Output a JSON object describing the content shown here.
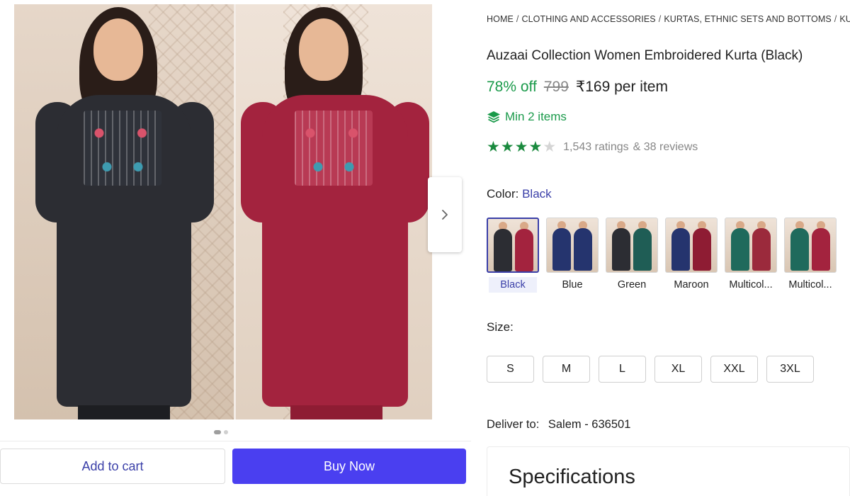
{
  "breadcrumb": {
    "items": [
      "HOME",
      "CLOTHING AND ACCESSORIES",
      "KURTAS, ETHNIC SETS AND BOTTOMS",
      "KURTA"
    ],
    "separator": "/"
  },
  "product": {
    "title": "Auzaai Collection Women Embroidered Kurta (Black)",
    "discount": "78% off",
    "mrp": "799",
    "price": "₹169 per item",
    "min_items": "Min 2 items",
    "rating": {
      "stars_filled": 4,
      "stars_total": 5,
      "ratings_text": "1,543 ratings",
      "reviews_text": "& 38 reviews"
    }
  },
  "gallery": {
    "image_count": 2,
    "active_index": 0,
    "next_icon": "chevron-right-icon",
    "figures": [
      {
        "kurta_color": "#2c2d33",
        "pants_color": "#1d1e22"
      },
      {
        "kurta_color": "#a3233e",
        "pants_color": "#8e1c33"
      }
    ]
  },
  "actions": {
    "add_to_cart": "Add to cart",
    "buy_now": "Buy Now"
  },
  "color": {
    "label": "Color:",
    "selected": "Black",
    "options": [
      {
        "label": "Black",
        "a": "#2c2d33",
        "b": "#a3233e",
        "selected": true
      },
      {
        "label": "Blue",
        "a": "#25346e",
        "b": "#25346e",
        "selected": false
      },
      {
        "label": "Green",
        "a": "#2c2d33",
        "b": "#1f5d55",
        "selected": false
      },
      {
        "label": "Maroon",
        "a": "#25346e",
        "b": "#8e1c33",
        "selected": false
      },
      {
        "label": "Multicol...",
        "a": "#1f6a5c",
        "b": "#9b2a3c",
        "selected": false
      },
      {
        "label": "Multicol...",
        "a": "#1f6a5c",
        "b": "#a3233e",
        "selected": false
      }
    ]
  },
  "size": {
    "label": "Size:",
    "options": [
      "S",
      "M",
      "L",
      "XL",
      "XXL",
      "3XL"
    ]
  },
  "delivery": {
    "label": "Deliver to:",
    "location": "Salem - 636501"
  },
  "specifications": {
    "title": "Specifications"
  },
  "colors": {
    "accent": "#3a3fa8",
    "buy_button": "#4a3ff0",
    "green": "#1a9a4a"
  }
}
